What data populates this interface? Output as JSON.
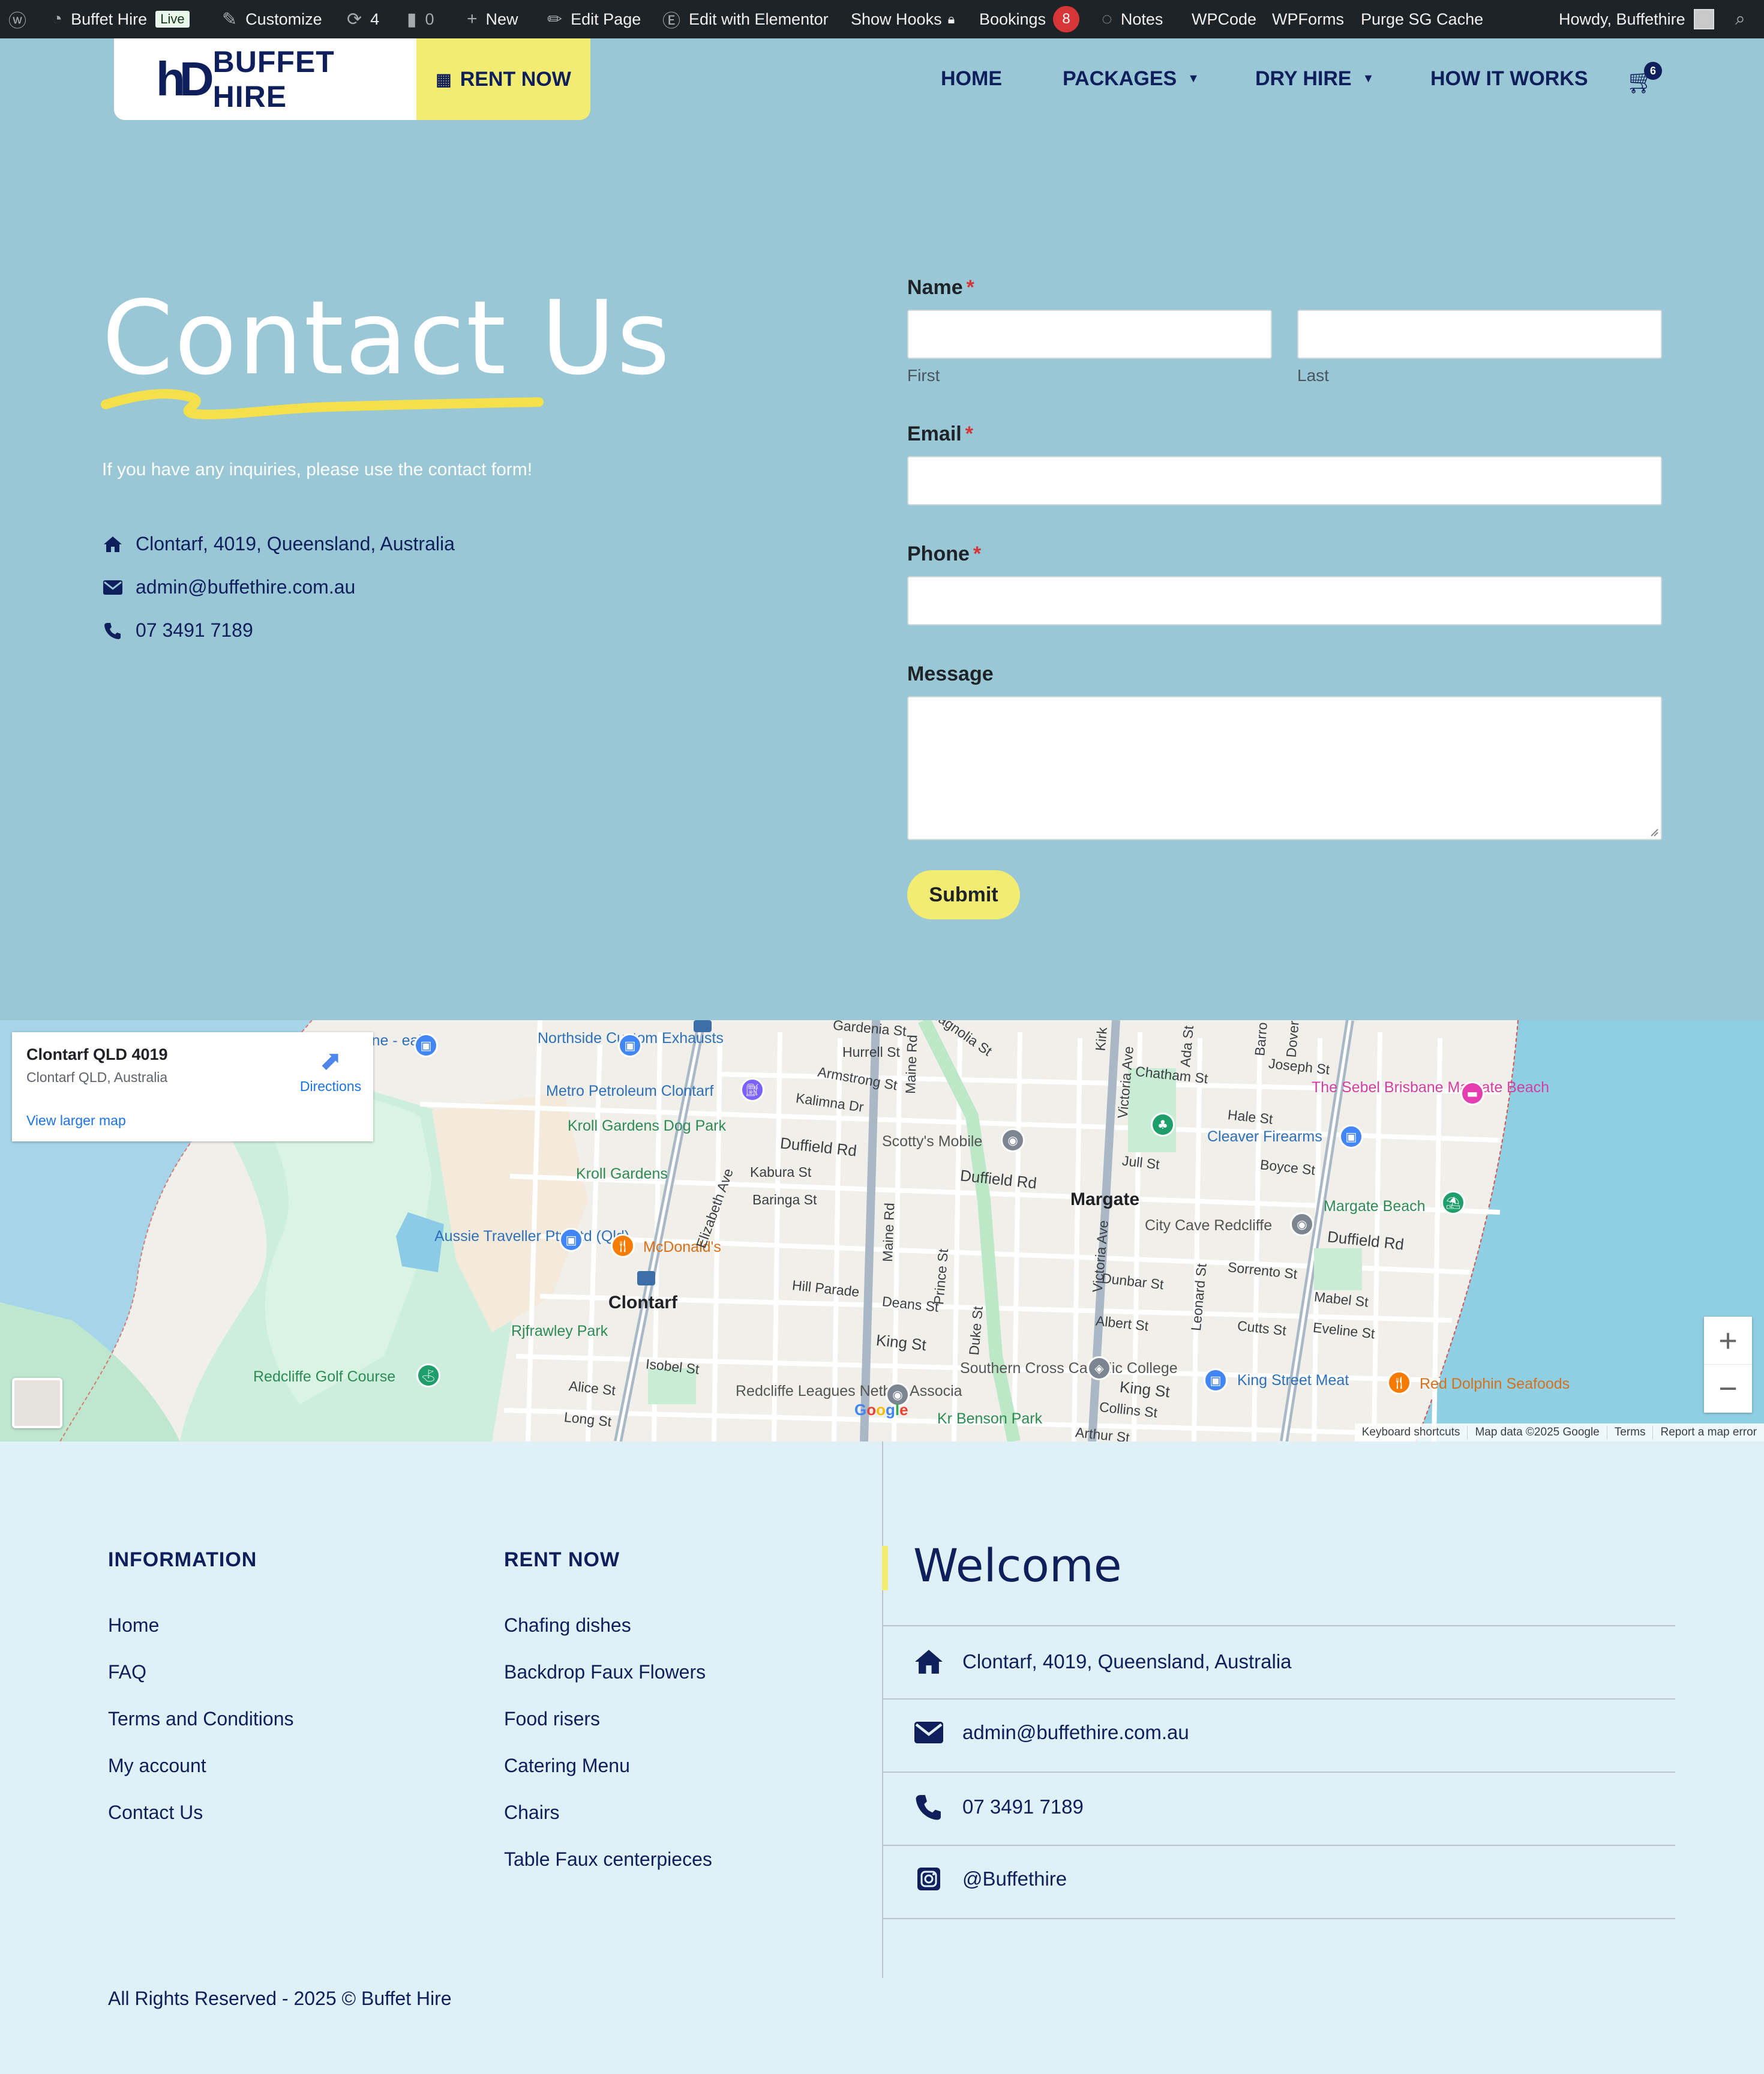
{
  "admin_bar": {
    "site_name": "Buffet Hire",
    "live_badge": "Live",
    "customize": "Customize",
    "updates_count": "4",
    "comments_count": "0",
    "new": "New",
    "edit_page": "Edit Page",
    "edit_elementor": "Edit with Elementor",
    "show_hooks": "Show Hooks",
    "bookings": "Bookings",
    "bookings_count": "8",
    "notes": "Notes",
    "wpcode": "WPCode",
    "wpforms": "WPForms",
    "purge": "Purge SG Cache",
    "howdy": "Howdy, Buffethire"
  },
  "header": {
    "logo_text": "BUFFET HIRE",
    "logo_mark": "hD",
    "rent_now": "RENT NOW",
    "nav": [
      "HOME",
      "PACKAGES",
      "DRY HIRE",
      "HOW IT WORKS"
    ],
    "cart_count": "6"
  },
  "hero": {
    "title": "Contact Us",
    "subtitle": "If you have any inquiries, please use the contact form!",
    "address": "Clontarf, 4019, Queensland, Australia",
    "email": "admin@buffethire.com.au",
    "phone": "07 3491 7189"
  },
  "form": {
    "name_label": "Name",
    "first_sub": "First",
    "last_sub": "Last",
    "email_label": "Email",
    "phone_label": "Phone",
    "message_label": "Message",
    "required_mark": "*",
    "submit": "Submit"
  },
  "map": {
    "card_title": "Clontarf QLD 4019",
    "card_address": "Clontarf QLD, Australia",
    "directions": "Directions",
    "view_larger": "View larger map",
    "footer": [
      "Keyboard shortcuts",
      "Map data ©2025 Google",
      "Terms",
      "Report a map error"
    ],
    "google": "Google",
    "zoom_in": "+",
    "zoom_out": "−",
    "labels": {
      "northside": "Northside Custom Exhausts",
      "dealer": "ine - ealer",
      "metro": "Metro Petroleum Clontarf",
      "kroll_dog": "Kroll Gardens Dog Park",
      "kroll": "Kroll Gardens",
      "aussie": "Aussie Traveller Pty Ltd (Qld)",
      "mcdonalds": "McDonald's",
      "clontarf": "Clontarf",
      "rjfrawley": "Rjfrawley Park",
      "golf": "Redcliffe Golf Course",
      "scottys": "Scotty's Mobile",
      "margate": "Margate",
      "citycave": "City Cave Redcliffe",
      "sebel": "The Sebel Brisbane Margate Beach",
      "cleaver": "Cleaver Firearms",
      "margate_beach": "Margate Beach",
      "southern_cross": "Southern Cross Catholic College",
      "leagues": "Redcliffe Leagues Netball Associa",
      "benson": "Kr Benson Park",
      "king_meat": "King Street Meat",
      "red_dolphin": "Red Dolphin Seafoods",
      "gardenia": "Gardenia St",
      "magnolia": "Magnolia St",
      "hurrell": "Hurrell St",
      "armstrong": "Armstrong St",
      "kalimna": "Kalimna Dr",
      "duffield1": "Duffield Rd",
      "duffield2": "Duffield Rd",
      "duffield3": "Duffield Rd",
      "kabura": "Kabura St",
      "baringa": "Baringa St",
      "elizabeth": "Elizabeth Ave",
      "maine1": "Maine Rd",
      "maine2": "Maine Rd",
      "victoria1": "Victoria Ave",
      "victoria2": "Victoria Ave",
      "chatham": "Chatham St",
      "joseph": "Joseph St",
      "hale": "Hale St",
      "boyce": "Boyce St",
      "jull": "Jull St",
      "dunbar": "Dunbar St",
      "sorrento": "Sorrento St",
      "albert": "Albert St",
      "cutts": "Cutts St",
      "mabel": "Mabel St",
      "eveline": "Eveline St",
      "hill": "Hill Parade",
      "deans": "Deans St",
      "prince": "Prince St",
      "duke": "Duke St",
      "leonard": "Leonard St",
      "king1": "King St",
      "king2": "King St",
      "collins": "Collins St",
      "isobel": "Isobel St",
      "alice": "Alice St",
      "long": "Long St",
      "arthur": "Arthur St",
      "ada": "Ada St",
      "kirk": "Kirk",
      "barro": "Barro",
      "dover": "Dover"
    }
  },
  "footer": {
    "info_head": "INFORMATION",
    "info_links": [
      "Home",
      "FAQ",
      "Terms and Conditions",
      "My account",
      "Contact Us"
    ],
    "rent_head": "RENT NOW",
    "rent_links": [
      "Chafing dishes",
      "Backdrop Faux Flowers",
      "Food risers",
      "Catering Menu",
      "Chairs",
      "Table Faux centerpieces"
    ],
    "welcome": "Welcome",
    "address": "Clontarf, 4019, Queensland, Australia",
    "email": "admin@buffethire.com.au",
    "phone": "07 3491 7189",
    "instagram": "@Buffethire",
    "copyright": "All Rights Reserved - 2025 © Buffet Hire"
  }
}
